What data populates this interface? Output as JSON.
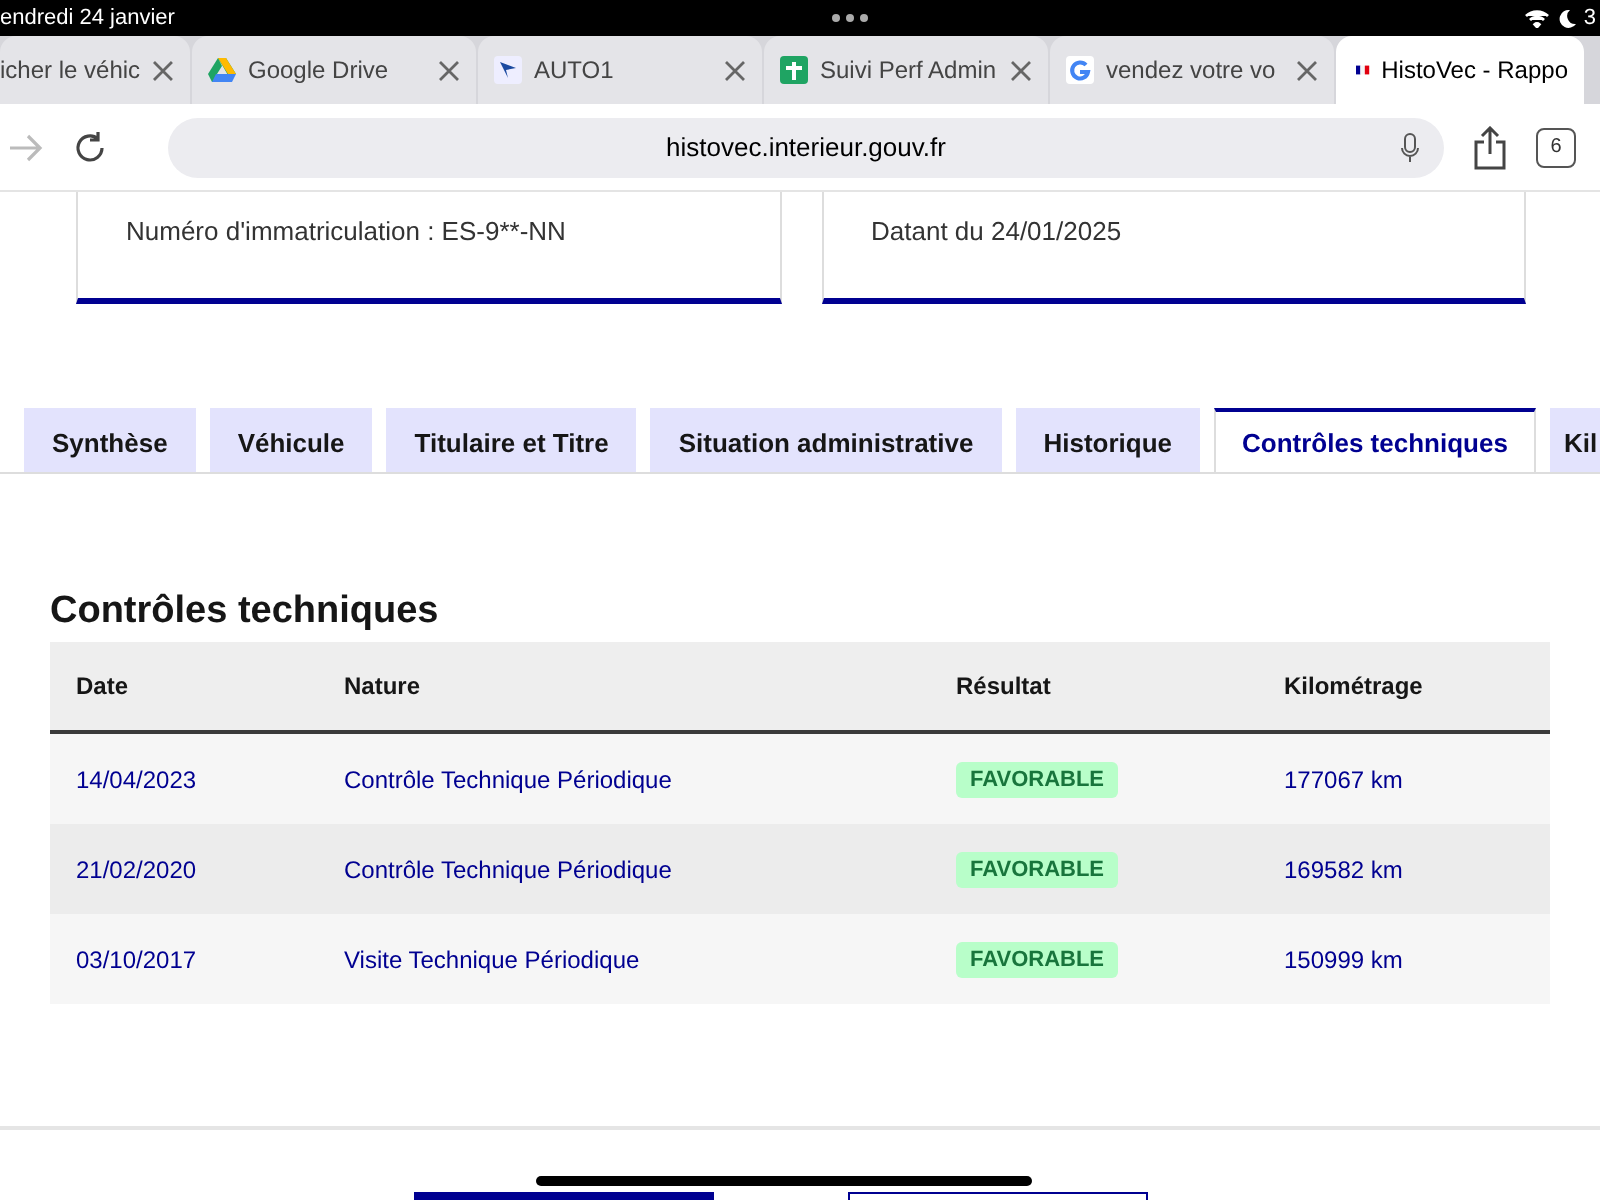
{
  "status_bar": {
    "date": "endredi 24 janvier",
    "battery": "3"
  },
  "browser_tabs": [
    {
      "title": "icher le véhic",
      "selected": false
    },
    {
      "title": "Google Drive",
      "selected": false
    },
    {
      "title": "AUTO1",
      "selected": false
    },
    {
      "title": "Suivi Perf Admin",
      "selected": false
    },
    {
      "title": "vendez votre vo",
      "selected": false
    },
    {
      "title": "HistoVec - Rappo",
      "selected": true
    }
  ],
  "address_bar": {
    "url": "histovec.interieur.gouv.fr",
    "tab_count": "6"
  },
  "cards": [
    {
      "text": "Numéro d'immatriculation : ES-9**-NN"
    },
    {
      "text": "Datant du 24/01/2025"
    }
  ],
  "page_tabs": [
    {
      "label": "Synthèse",
      "selected": false
    },
    {
      "label": "Véhicule",
      "selected": false
    },
    {
      "label": "Titulaire et Titre",
      "selected": false
    },
    {
      "label": "Situation administrative",
      "selected": false
    },
    {
      "label": "Historique",
      "selected": false
    },
    {
      "label": "Contrôles techniques",
      "selected": true
    },
    {
      "label": "Kil",
      "selected": false
    }
  ],
  "section": {
    "title": "Contrôles techniques",
    "table": {
      "columns": [
        "Date",
        "Nature",
        "Résultat",
        "Kilométrage"
      ],
      "rows": [
        [
          "14/04/2023",
          "Contrôle Technique Périodique",
          "FAVORABLE",
          "177067 km"
        ],
        [
          "21/02/2020",
          "Contrôle Technique Périodique",
          "FAVORABLE",
          "169582 km"
        ],
        [
          "03/10/2017",
          "Visite Technique Périodique",
          "FAVORABLE",
          "150999 km"
        ]
      ]
    }
  }
}
